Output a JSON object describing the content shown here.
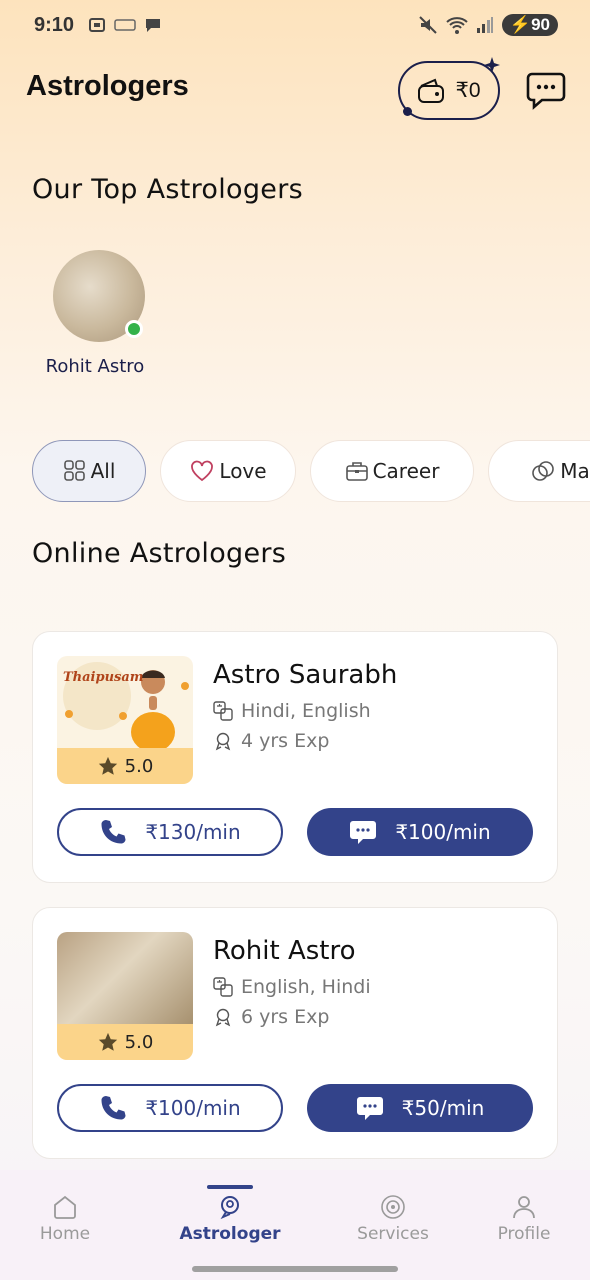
{
  "status_bar": {
    "time": "9:10",
    "battery": "90"
  },
  "header": {
    "title": "Astrologers",
    "wallet_amount": "₹0"
  },
  "top_section": {
    "title": "Our Top Astrologers",
    "astrologers": [
      {
        "name": "Rohit Astro",
        "online": true
      }
    ]
  },
  "categories": [
    {
      "label": "All",
      "active": true
    },
    {
      "label": "Love",
      "active": false
    },
    {
      "label": "Career",
      "active": false
    },
    {
      "label": "Marr",
      "active": false
    }
  ],
  "online_section": {
    "title": "Online Astrologers"
  },
  "astrologers": [
    {
      "name": "Astro Saurabh",
      "languages": "Hindi, English",
      "experience": "4 yrs Exp",
      "rating": "5.0",
      "image_text": "Thaipusam",
      "call_price": "₹130/min",
      "chat_price": "₹100/min"
    },
    {
      "name": "Rohit Astro",
      "languages": "English, Hindi",
      "experience": "6 yrs Exp",
      "rating": "5.0",
      "call_price": "₹100/min",
      "chat_price": "₹50/min"
    }
  ],
  "bottom_nav": {
    "items": [
      {
        "label": "Home",
        "active": false
      },
      {
        "label": "Astrologer",
        "active": true
      },
      {
        "label": "Services",
        "active": false
      },
      {
        "label": "Profile",
        "active": false
      }
    ]
  },
  "colors": {
    "primary": "#33438a",
    "accent": "#fbd48a",
    "online": "#34b24a"
  }
}
